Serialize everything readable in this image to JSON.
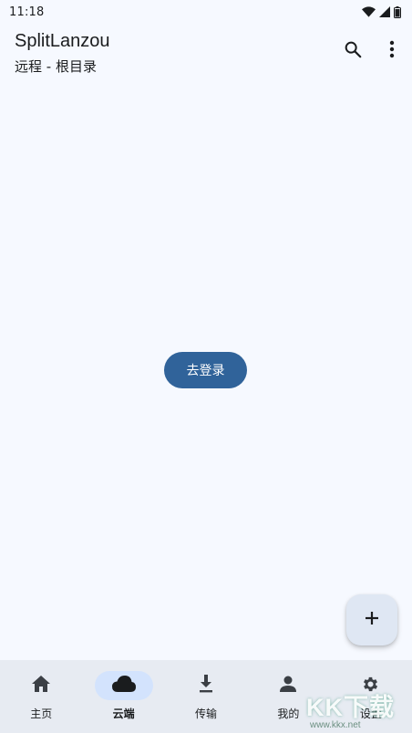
{
  "status_bar": {
    "time": "11:18",
    "icons": [
      "wifi-icon",
      "signal-icon",
      "battery-icon"
    ]
  },
  "app_bar": {
    "title": "SplitLanzou",
    "subtitle": "远程 - 根目录",
    "actions": [
      "search-icon",
      "more-vert-icon"
    ]
  },
  "main": {
    "login_button_label": "去登录"
  },
  "fab": {
    "icon": "plus-icon"
  },
  "bottom_nav": {
    "items": [
      {
        "label": "主页",
        "icon": "home-icon",
        "active": false
      },
      {
        "label": "云端",
        "icon": "cloud-icon",
        "active": true
      },
      {
        "label": "传输",
        "icon": "download-icon",
        "active": false
      },
      {
        "label": "我的",
        "icon": "person-icon",
        "active": false
      },
      {
        "label": "设置",
        "icon": "gear-icon",
        "active": false
      }
    ]
  },
  "watermark": {
    "logo_text": "KK下载",
    "url": "www.kkx.net"
  },
  "colors": {
    "background": "#f6f9ff",
    "primary": "#30639a",
    "nav_background": "#e7ebf2",
    "nav_indicator": "#d3e3fd",
    "fab": "#dfe7f3"
  }
}
